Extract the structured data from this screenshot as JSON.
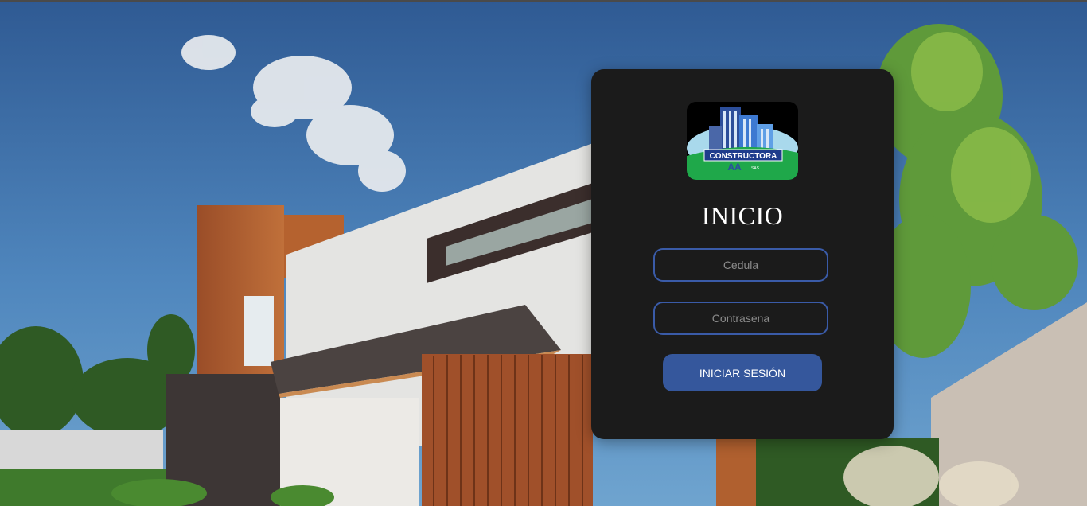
{
  "login": {
    "title": "INICIO",
    "logo_text": "CONSTRUCTORA",
    "logo_sub": "SAS",
    "cedula_placeholder": "Cedula",
    "password_placeholder": "Contrasena",
    "submit_label": "INICIAR SESIÓN"
  },
  "colors": {
    "card_background": "#1b1b1b",
    "field_border": "#3a5ba8",
    "button_background": "#35579c",
    "title_text": "#ffffff"
  },
  "icons": {
    "logo": "building-logo"
  }
}
